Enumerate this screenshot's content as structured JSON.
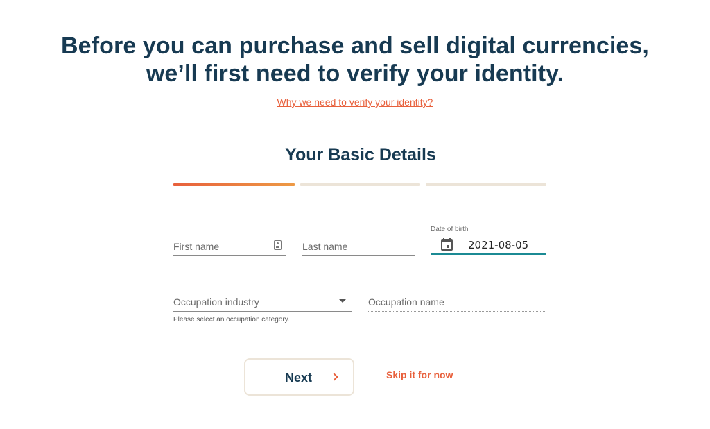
{
  "header": {
    "headline_line1": "Before you can purchase and sell digital currencies,",
    "headline_line2": "we’ll first need to verify your identity.",
    "why_link": "Why we need to verify your identity?"
  },
  "form": {
    "title": "Your Basic Details",
    "progress": {
      "current_step": 1,
      "total_steps": 3
    },
    "first_name": {
      "placeholder": "First name",
      "icon": "contact-card-icon"
    },
    "last_name": {
      "placeholder": "Last name"
    },
    "date_of_birth": {
      "label": "Date of birth",
      "value": "2021-08-05",
      "icon": "calendar-icon"
    },
    "occupation_industry": {
      "placeholder": "Occupation industry",
      "helper": "Please select an occupation category.",
      "icon": "dropdown-caret-icon"
    },
    "occupation_name": {
      "placeholder": "Occupation name"
    }
  },
  "actions": {
    "next_label": "Next",
    "next_icon": "chevron-right-icon",
    "skip_label": "Skip it for now"
  },
  "colors": {
    "heading": "#173a52",
    "accent": "#e8603c",
    "accent_gradient_end": "#ed9a45",
    "inactive_step": "#ece4d8",
    "focus_underline": "#1b8a94"
  }
}
